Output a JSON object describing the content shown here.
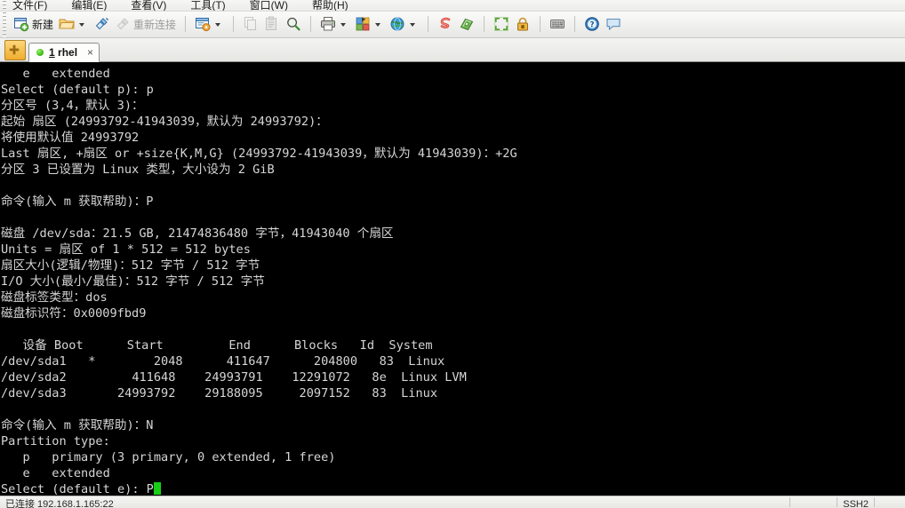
{
  "window": {
    "title": "1 rhel"
  },
  "menubar": {
    "items": [
      {
        "label": "文件(F)",
        "name": "menu-file"
      },
      {
        "label": "编辑(E)",
        "name": "menu-edit"
      },
      {
        "label": "查看(V)",
        "name": "menu-view"
      },
      {
        "label": "工具(T)",
        "name": "menu-tools"
      },
      {
        "label": "窗口(W)",
        "name": "menu-window"
      },
      {
        "label": "帮助(H)",
        "name": "menu-help"
      }
    ]
  },
  "toolbar": {
    "new_label": "新建",
    "reconnect_label": "重新连接"
  },
  "tabbar": {
    "new_tab_tooltip": "新建标签",
    "tab_index": "1",
    "tab_name": "rhel",
    "close_label": "×"
  },
  "terminal": {
    "prompt_cursor_char": "",
    "lines": [
      "   e   extended",
      "Select (default p): p",
      "分区号 (3,4，默认 3)：",
      "起始 扇区 (24993792-41943039，默认为 24993792)：",
      "将使用默认值 24993792",
      "Last 扇区, +扇区 or +size{K,M,G} (24993792-41943039，默认为 41943039)：+2G",
      "分区 3 已设置为 Linux 类型，大小设为 2 GiB",
      "",
      "命令(输入 m 获取帮助)：P",
      "",
      "磁盘 /dev/sda：21.5 GB, 21474836480 字节，41943040 个扇区",
      "Units = 扇区 of 1 * 512 = 512 bytes",
      "扇区大小(逻辑/物理)：512 字节 / 512 字节",
      "I/O 大小(最小/最佳)：512 字节 / 512 字节",
      "磁盘标签类型：dos",
      "磁盘标识符：0x0009fbd9",
      "",
      "   设备 Boot      Start         End      Blocks   Id  System",
      "/dev/sda1   *        2048      411647      204800   83  Linux",
      "/dev/sda2         411648    24993791    12291072   8e  Linux LVM",
      "/dev/sda3       24993792    29188095     2097152   83  Linux",
      "",
      "命令(输入 m 获取帮助)：N",
      "Partition type:",
      "   p   primary (3 primary, 0 extended, 1 free)",
      "   e   extended",
      "Select (default e): P"
    ],
    "colors": {
      "background": "#000000",
      "foreground": "#d6d6d6",
      "cursor": "#16ce16"
    }
  },
  "statusbar": {
    "connection": "已连接 192.168.1.165:22",
    "protocol": "SSH2"
  }
}
